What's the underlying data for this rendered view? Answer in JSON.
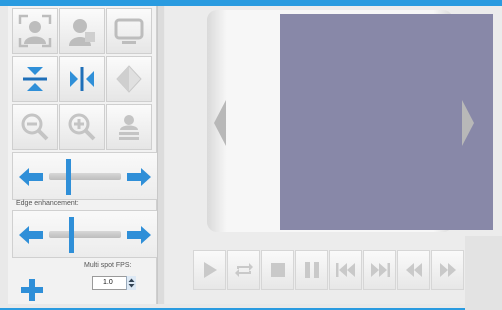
{
  "toolbar": {
    "buttons": [
      {
        "id": "face-select",
        "icon": "face-frame-icon"
      },
      {
        "id": "face-profile",
        "icon": "face-profile-icon"
      },
      {
        "id": "screen",
        "icon": "monitor-icon"
      },
      {
        "id": "flip-vertical",
        "icon": "flip-vertical-icon"
      },
      {
        "id": "flip-horizontal",
        "icon": "flip-horizontal-icon"
      },
      {
        "id": "mirror",
        "icon": "mirror-icon"
      },
      {
        "id": "zoom-out",
        "icon": "zoom-out-icon"
      },
      {
        "id": "zoom-in",
        "icon": "zoom-in-icon"
      },
      {
        "id": "stack",
        "icon": "stack-user-icon"
      }
    ]
  },
  "slider1": {
    "value": 0.25
  },
  "edge": {
    "label": "Edge enhancement:",
    "value": 0.3
  },
  "fps": {
    "label": "Multi spot FPS:",
    "value": "1.0"
  },
  "player": {
    "buttons": [
      "play-icon",
      "loop-icon",
      "stop-icon",
      "pause-icon",
      "skip-back-icon",
      "skip-forward-icon",
      "rewind-icon",
      "fast-forward-icon"
    ]
  },
  "colors": {
    "accent": "#2f8fd8",
    "screen": "#8888a8",
    "brand_blue": "#2a9be0"
  }
}
